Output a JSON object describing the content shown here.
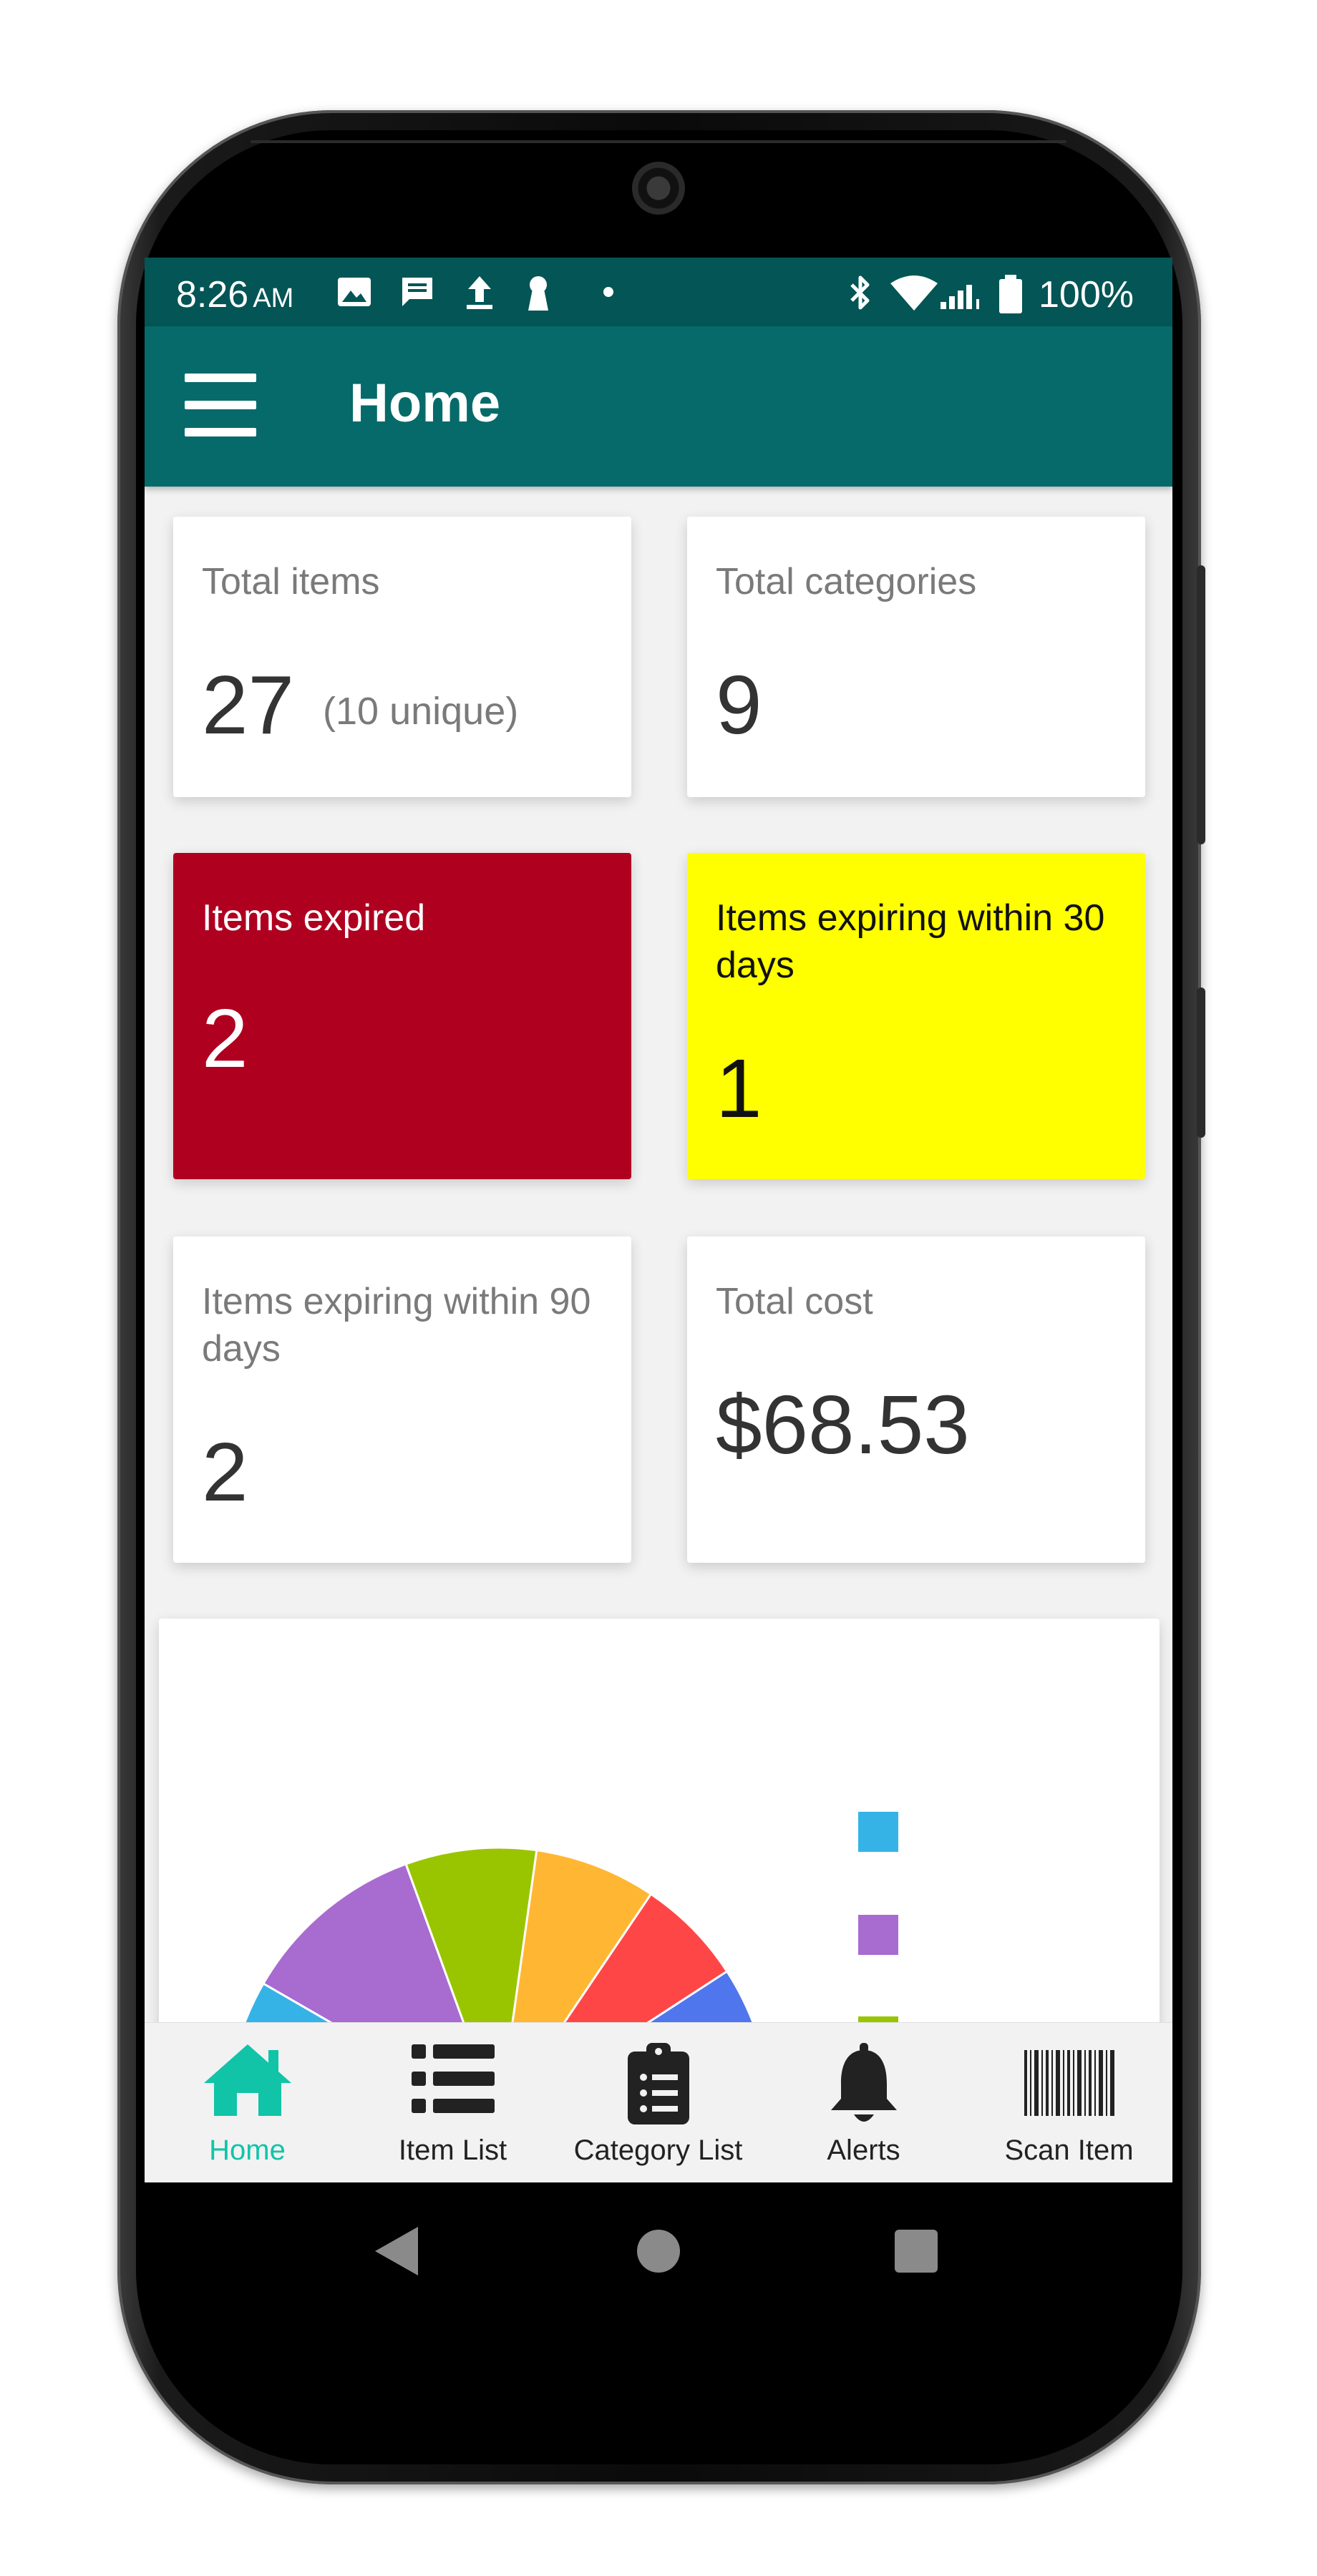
{
  "status_bar": {
    "time": "8:26",
    "ampm": "AM",
    "battery": "100%"
  },
  "app_bar": {
    "title": "Home",
    "menu_icon": "hamburger-menu-icon"
  },
  "cards": {
    "total_items": {
      "label": "Total items",
      "value": "27",
      "sub": "(10 unique)"
    },
    "total_categories": {
      "label": "Total categories",
      "value": "9"
    },
    "items_expired": {
      "label": "Items expired",
      "value": "2",
      "color": "#af0020"
    },
    "expiring_30": {
      "label": "Items expiring within 30 days",
      "value": "1",
      "color": "#ffff00"
    },
    "expiring_90": {
      "label": "Items expiring within 90 days",
      "value": "2"
    },
    "total_cost": {
      "label": "Total cost",
      "value": "$68.53"
    }
  },
  "chart": {
    "type": "pie",
    "slice_colors": [
      "#36b3e6",
      "#a86bd0",
      "#99c500",
      "#ffb733",
      "#ff4646",
      "#4f76ed",
      "#22b573"
    ],
    "legend_colors": [
      "#36b3e6",
      "#a86bd0",
      "#99c500"
    ]
  },
  "bottom_nav": {
    "items": [
      {
        "label": "Home",
        "icon": "home-icon",
        "active": true
      },
      {
        "label": "Item List",
        "icon": "list-icon",
        "active": false
      },
      {
        "label": "Category List",
        "icon": "clipboard-list-icon",
        "active": false
      },
      {
        "label": "Alerts",
        "icon": "bell-icon",
        "active": false
      },
      {
        "label": "Scan Item",
        "icon": "barcode-icon",
        "active": false
      }
    ],
    "active_color": "#11c4a8"
  }
}
